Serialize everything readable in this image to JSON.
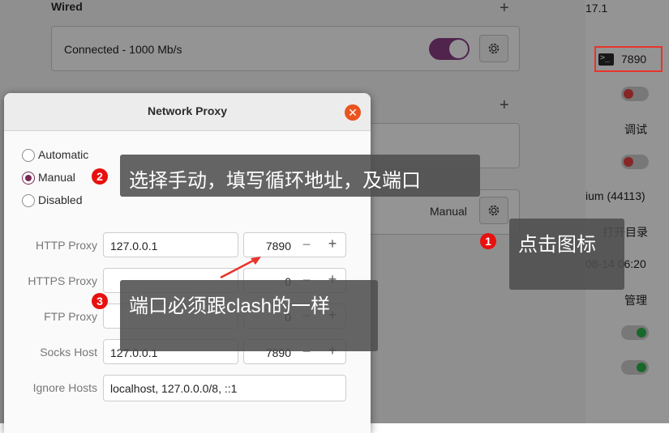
{
  "background": {
    "wired_title": "Wired",
    "wired_status": "Connected - 1000 Mb/s",
    "proxy_mode_value": "Manual",
    "right_panel": {
      "top_partial": "17.1",
      "terminal_port": "7890",
      "debug_label": "调试",
      "version_text": "ium (44113)",
      "open_dir_label": "打开目录",
      "datetime_text": "08-14 06:20",
      "manage_label": "管理"
    },
    "colors": {
      "toggle_on": "#8a3e86",
      "status_green": "#2bb34a",
      "status_red": "#e84343"
    }
  },
  "dialog": {
    "title": "Network Proxy",
    "close_icon": "close-icon",
    "options": [
      {
        "label": "Automatic",
        "selected": false
      },
      {
        "label": "Manual",
        "selected": true
      },
      {
        "label": "Disabled",
        "selected": false
      }
    ],
    "fields": {
      "http": {
        "label": "HTTP Proxy",
        "host": "127.0.0.1",
        "port": "7890"
      },
      "https": {
        "label": "HTTPS Proxy",
        "host": "",
        "port": "0"
      },
      "ftp": {
        "label": "FTP Proxy",
        "host": "",
        "port": "0"
      },
      "socks": {
        "label": "Socks Host",
        "host": "127.0.0.1",
        "port": "7890"
      },
      "ignore": {
        "label": "Ignore Hosts",
        "value": "localhost, 127.0.0.0/8, ::1"
      }
    }
  },
  "annotations": {
    "step1": {
      "number": "1",
      "text": "点击图标"
    },
    "step2": {
      "number": "2",
      "text": "选择手动，填写循环地址，及端口"
    },
    "step3": {
      "number": "3",
      "text": "端口必须跟clash的一样"
    },
    "highlight_color": "#e8342a"
  }
}
